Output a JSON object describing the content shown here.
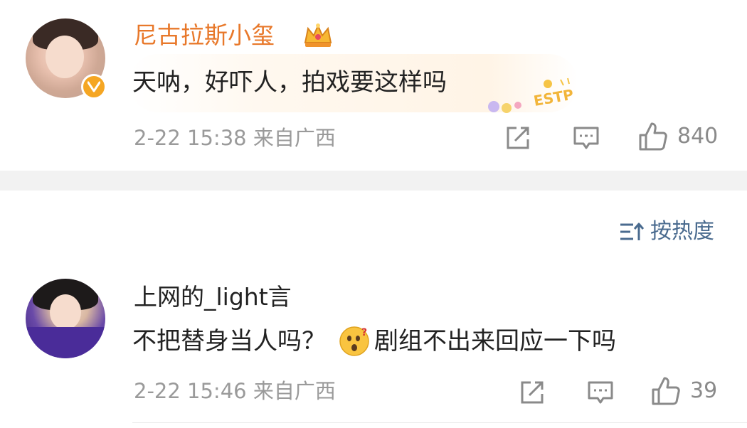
{
  "comments": [
    {
      "username": "尼古拉斯小玺",
      "text": "天呐，好吓人，拍戏要这样吗",
      "meta": "2-22 15:38 来自广西",
      "likes": "840",
      "badge_icon": "crown-icon",
      "verified_icon": "verified-v-icon",
      "decoration_text": "ESTP"
    },
    {
      "username": "上网的_light言",
      "text_before_emoji": "不把替身当人吗？",
      "emoji": "thinking-face-emoji",
      "text_after_emoji": "剧组不出来回应一下吗",
      "meta": "2-22 15:46 来自广西",
      "likes": "39"
    }
  ],
  "sort": {
    "label": "按热度",
    "icon": "sort-icon"
  },
  "colors": {
    "username_vip": "#e8782a",
    "meta": "#9a9a9a",
    "sort": "#4a6b8f",
    "verified": "#f5a623"
  }
}
